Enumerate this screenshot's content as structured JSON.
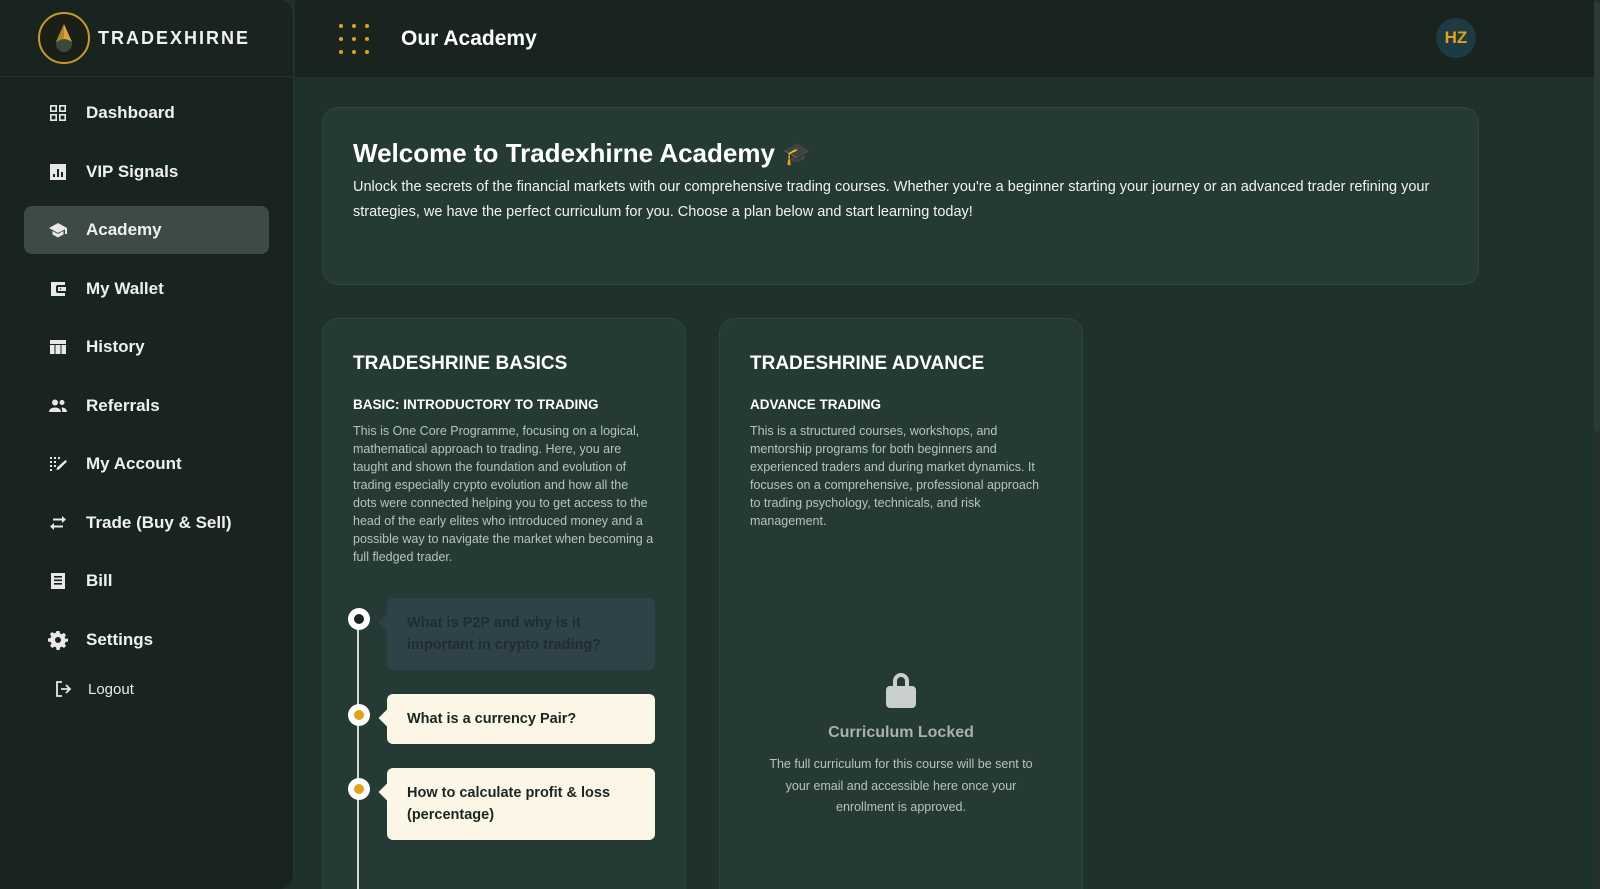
{
  "brand": {
    "name": "TRADEXHIRNE"
  },
  "header": {
    "title": "Our Academy",
    "avatar_initials": "HZ"
  },
  "sidebar": {
    "items": [
      {
        "label": "Dashboard",
        "icon": "dashboard-icon",
        "active": false
      },
      {
        "label": "VIP Signals",
        "icon": "chart-icon",
        "active": false
      },
      {
        "label": "Academy",
        "icon": "graduation-cap-icon",
        "active": true
      },
      {
        "label": "My Wallet",
        "icon": "wallet-icon",
        "active": false
      },
      {
        "label": "History",
        "icon": "history-table-icon",
        "active": false
      },
      {
        "label": "Referrals",
        "icon": "people-icon",
        "active": false
      },
      {
        "label": "My Account",
        "icon": "account-icon",
        "active": false
      },
      {
        "label": "Trade (Buy & Sell)",
        "icon": "swap-arrows-icon",
        "active": false
      },
      {
        "label": "Bill",
        "icon": "receipt-icon",
        "active": false
      },
      {
        "label": "Settings",
        "icon": "gear-icon",
        "active": false
      }
    ],
    "logout_label": "Logout"
  },
  "welcome": {
    "title": "Welcome to Tradexhirne Academy",
    "cap_emoji": "🎓",
    "text": "Unlock the secrets of the financial markets with our comprehensive trading courses. Whether you're a beginner starting your journey or an advanced trader refining your strategies, we have the perfect curriculum for you. Choose a plan below and start learning today!"
  },
  "courses": {
    "basics": {
      "title": "TRADESHRINE BASICS",
      "subtitle": "BASIC: INTRODUCTORY TO TRADING",
      "description": "This is One Core Programme, focusing on a logical, mathematical approach to trading. Here, you are taught and shown the foundation and evolution of trading especially crypto evolution and how all the dots were connected helping you to get access to the head of the early elites who introduced money and a possible way to navigate the market when becoming a full fledged trader.",
      "lessons": [
        "What is P2P and why is it important in crypto trading?",
        "What is a currency Pair?",
        "How to calculate profit & loss (percentage)"
      ]
    },
    "advance": {
      "title": "TRADESHRINE ADVANCE",
      "subtitle": "ADVANCE TRADING",
      "description": "This is a structured courses, workshops, and mentorship programs for both beginners and experienced traders and during market dynamics. It focuses on a comprehensive, professional approach to trading psychology, technicals, and risk management.",
      "locked_title": "Curriculum Locked",
      "locked_text": "The full curriculum for this course will be sent to your email and accessible here once your enrollment is approved."
    }
  },
  "colors": {
    "accent": "#e0a21c",
    "background": "#1f312c",
    "sidebar": "#19241f",
    "card": "#263a35",
    "lesson_card": "#fbf6e6"
  }
}
